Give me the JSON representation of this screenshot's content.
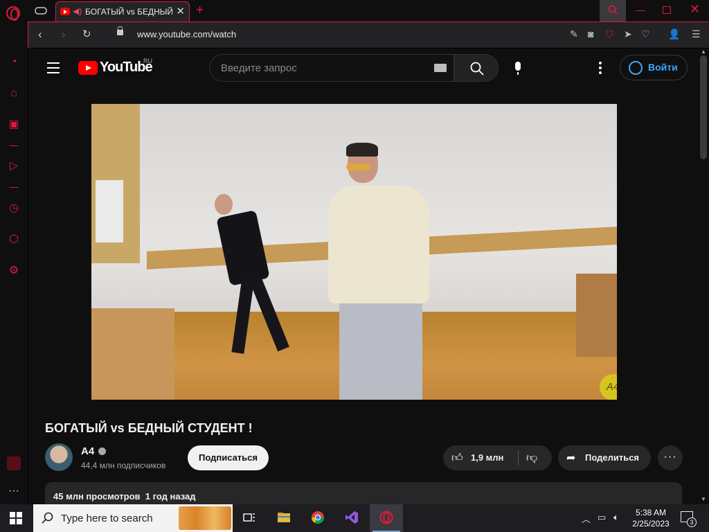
{
  "browser": {
    "tab": {
      "title": "БОГАТЫЙ vs БЕДНЫЙ СТУДЕНТ !"
    },
    "url": "www.youtube.com/watch",
    "accent_color": "#e0193c"
  },
  "youtube": {
    "logo_text": "YouTube",
    "region": "RU",
    "search_placeholder": "Введите запрос",
    "signin_label": "Войти",
    "video": {
      "title": "БОГАТЫЙ vs БЕДНЫЙ СТУДЕНТ !",
      "watermark": "A4"
    },
    "channel": {
      "name": "A4",
      "subscribers": "44,4 млн подписчиков"
    },
    "subscribe_label": "Подписаться",
    "likes": "1,9 млн",
    "share_label": "Поделиться",
    "more_label": "···",
    "description": {
      "views": "45 млн просмотров",
      "date": "1 год назад"
    }
  },
  "taskbar": {
    "search_placeholder": "Type here to search",
    "time": "5:38 AM",
    "date": "2/25/2023",
    "notifications": "3"
  }
}
